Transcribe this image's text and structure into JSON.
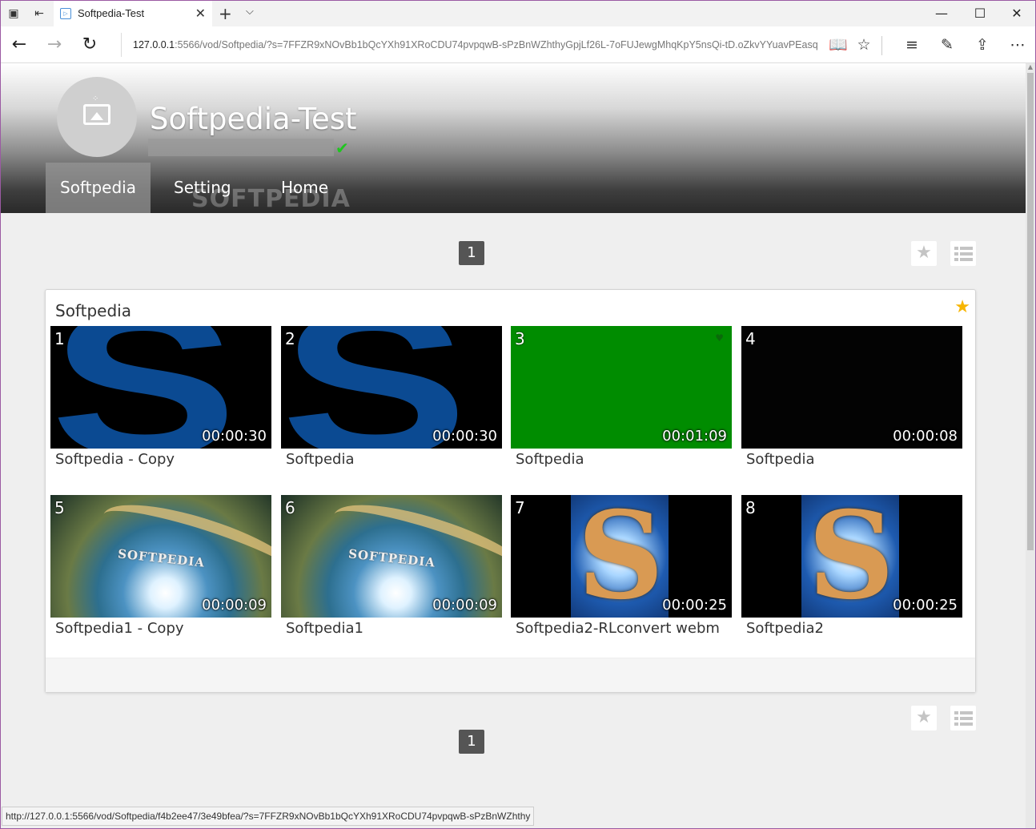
{
  "browser": {
    "tab_title": "Softpedia-Test",
    "url_host": "127.0.0.1",
    "url_rest": ":5566/vod/Softpedia/?s=7FFZR9xNOvBb1bQcYXh91XRoCDU74pvpqwB-sPzBnWZhthyGpjLf26L-7oFUJewgMhqKpY5nsQi-tD.oZkvYYuavPEasq",
    "status_url": "http://127.0.0.1:5566/vod/Softpedia/f4b2ee47/3e49bfea/?s=7FFZR9xNOvBb1bQcYXh91XRoCDU74pvpqwB-sPzBnWZhthy"
  },
  "header": {
    "channel_title": "Softpedia-Test",
    "nav": [
      {
        "label": "Softpedia",
        "active": true
      },
      {
        "label": "Setting",
        "active": false
      },
      {
        "label": "Home",
        "active": false
      }
    ],
    "watermark": "SOFTPEDIA"
  },
  "pager": {
    "top_page": "1",
    "bottom_page": "1"
  },
  "panel": {
    "title": "Softpedia",
    "videos": [
      {
        "index": "1",
        "duration": "00:00:30",
        "title": "Softpedia - Copy",
        "thumb": "blue-s"
      },
      {
        "index": "2",
        "duration": "00:00:30",
        "title": "Softpedia",
        "thumb": "blue-s"
      },
      {
        "index": "3",
        "duration": "00:01:09",
        "title": "Softpedia",
        "thumb": "green"
      },
      {
        "index": "4",
        "duration": "00:00:08",
        "title": "Softpedia",
        "thumb": "black"
      },
      {
        "index": "5",
        "duration": "00:00:09",
        "title": "Softpedia1 - Copy",
        "thumb": "earth"
      },
      {
        "index": "6",
        "duration": "00:00:09",
        "title": "Softpedia1",
        "thumb": "earth"
      },
      {
        "index": "7",
        "duration": "00:00:25",
        "title": "Softpedia2-RLconvert webm",
        "thumb": "mosaic-s"
      },
      {
        "index": "8",
        "duration": "00:00:25",
        "title": "Softpedia2",
        "thumb": "mosaic-s"
      }
    ],
    "earth_logo": "SOFTPEDIA"
  },
  "colors": {
    "accent_star": "#f7b500",
    "verified": "#1ec61e",
    "pager_bg": "#555555"
  }
}
